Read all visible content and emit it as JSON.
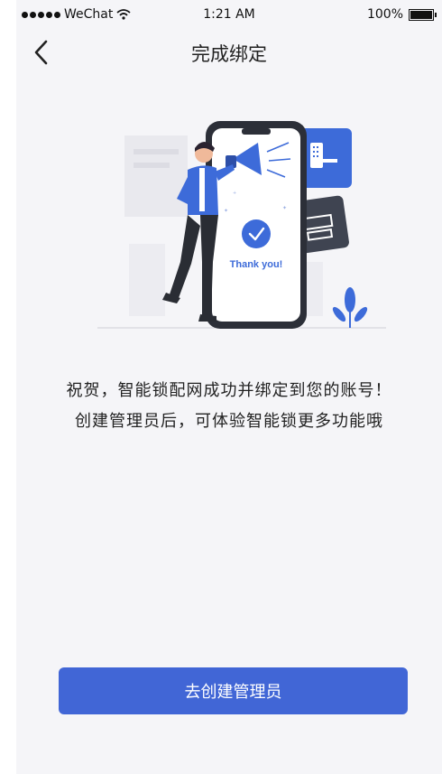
{
  "status_bar": {
    "carrier": "WeChat",
    "time": "1:21 AM",
    "battery": "100%"
  },
  "nav": {
    "title": "完成绑定",
    "back_icon": "chevron-left-icon"
  },
  "illustration": {
    "phone_text": "Thank you!",
    "icons": [
      "megaphone-icon",
      "checkmark-icon",
      "door-lock-icon",
      "router-icon",
      "plant-icon"
    ],
    "accent_color": "#3d6bd9"
  },
  "message": {
    "line1": "祝贺，智能锁配网成功并绑定到您的账号！",
    "line2": "创建管理员后，可体验智能锁更多功能哦"
  },
  "actions": {
    "create_admin_label": "去创建管理员",
    "button_color": "#4166d6"
  }
}
